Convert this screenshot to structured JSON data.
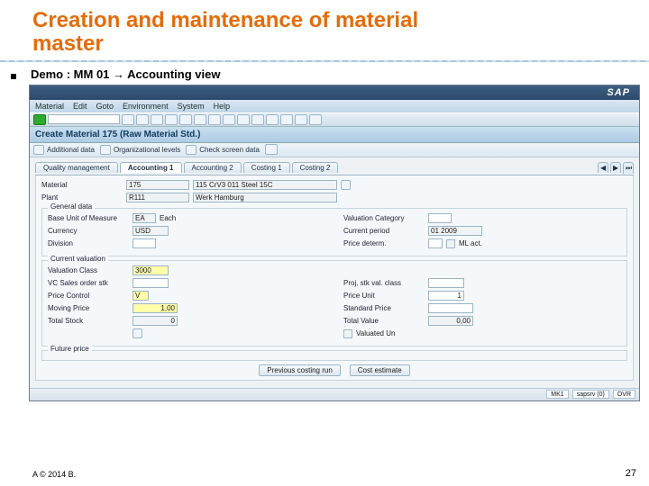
{
  "slide": {
    "title_line1": "Creation and maintenance of material",
    "title_line2": "master",
    "bullet": "Demo : MM 01 → Accounting view",
    "footer": "A © 2014 B.",
    "page": "27"
  },
  "sap": {
    "menus": [
      "Material",
      "Edit",
      "Goto",
      "Environment",
      "System",
      "Help"
    ],
    "logo": "SAP",
    "subtitle": "Create Material 175 (Raw Material Std.)",
    "tool2": {
      "b1": "Additional data",
      "b2": "Organizational levels",
      "b3": "Check screen data"
    },
    "tabs": {
      "t1": "Quality management",
      "t2": "Accounting 1",
      "t3": "Accounting 2",
      "t4": "Costing 1",
      "t5": "Costing 2",
      "navL": "◀",
      "navR": "▶",
      "navE": "⏭"
    },
    "header": {
      "material_lbl": "Material",
      "material_val": "175",
      "material_desc": "115 CrV3 011 Steel 15C",
      "plant_lbl": "Plant",
      "plant_val": "R111",
      "plant_desc": "Werk Hamburg"
    },
    "grp1": {
      "title": "General data",
      "buom_lbl": "Base Unit of Measure",
      "buom_val": "EA",
      "buom_desc": "Each",
      "curr_lbl": "Currency",
      "curr_val": "USD",
      "div_lbl": "Division",
      "div_val": "",
      "valcat_lbl": "Valuation Category",
      "valcat_val": "",
      "curper_lbl": "Current period",
      "curper_val": "01 2009",
      "pricedet_lbl": "Price determ.",
      "pricedet_chk": "ML act."
    },
    "grp2": {
      "title": "Current valuation",
      "vclass_lbl": "Valuation Class",
      "vclass_val": "3000",
      "vcso_lbl": "VC Sales order stk",
      "vcso_val": "",
      "pctl_lbl": "Price Control",
      "pctl_val": "V",
      "mprice_lbl": "Moving Price",
      "mprice_val": "1,00",
      "tstock_lbl": "Total Stock",
      "tstock_val": "0",
      "pvc_lbl": "Proj. stk val. class",
      "pvc_val": "",
      "punit_lbl": "Price Unit",
      "punit_val": "1",
      "sprice_lbl": "Standard Price",
      "sprice_val": "",
      "tval_lbl": "Total Value",
      "tval_val": "0,00",
      "valun_chk": "Valuated Un"
    },
    "grp3title": "Future price",
    "btn_prev": "Previous costing run",
    "btn_cost": "Cost estimate",
    "status": {
      "s1": "MK1",
      "s2": "sapsrv (0)",
      "s3": "OVR"
    }
  }
}
